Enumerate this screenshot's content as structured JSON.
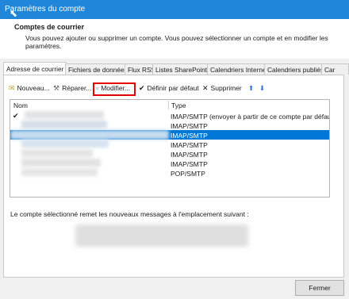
{
  "window": {
    "title": "Paramètres du compte"
  },
  "header": {
    "title": "Comptes de courrier",
    "description": "Vous pouvez ajouter ou supprimer un compte. Vous pouvez sélectionner un compte et en modifier les paramètres."
  },
  "tabs": [
    {
      "label": "Adresse de courrier"
    },
    {
      "label": "Fichiers de données"
    },
    {
      "label": "Flux RSS"
    },
    {
      "label": "Listes SharePoint"
    },
    {
      "label": "Calendriers Internet"
    },
    {
      "label": "Calendriers publiés"
    },
    {
      "label": "Car"
    }
  ],
  "toolbar": {
    "new_label": "Nouveau...",
    "repair_label": "Réparer...",
    "modify_label": "Modifier...",
    "default_label": "Définir par défaut",
    "delete_label": "Supprimer",
    "move_up_glyph": "⬆",
    "move_down_glyph": "⬇"
  },
  "list": {
    "columns": {
      "name": "Nom",
      "type": "Type"
    },
    "rows": [
      {
        "type": "IMAP/SMTP (envoyer à partir de ce compte par défaut)",
        "is_default": true,
        "selected": false
      },
      {
        "type": "IMAP/SMTP",
        "is_default": false,
        "selected": false
      },
      {
        "type": "IMAP/SMTP",
        "is_default": false,
        "selected": true
      },
      {
        "type": "IMAP/SMTP",
        "is_default": false,
        "selected": false
      },
      {
        "type": "IMAP/SMTP",
        "is_default": false,
        "selected": false
      },
      {
        "type": "IMAP/SMTP",
        "is_default": false,
        "selected": false
      },
      {
        "type": "POP/SMTP",
        "is_default": false,
        "selected": false
      }
    ]
  },
  "note": "Le compte sélectionné remet les nouveaux messages à l'emplacement suivant :",
  "footer": {
    "close_label": "Fermer"
  },
  "colors": {
    "titlebar": "#1f86d9",
    "selection": "#0078d7",
    "highlight": "#e60000"
  }
}
